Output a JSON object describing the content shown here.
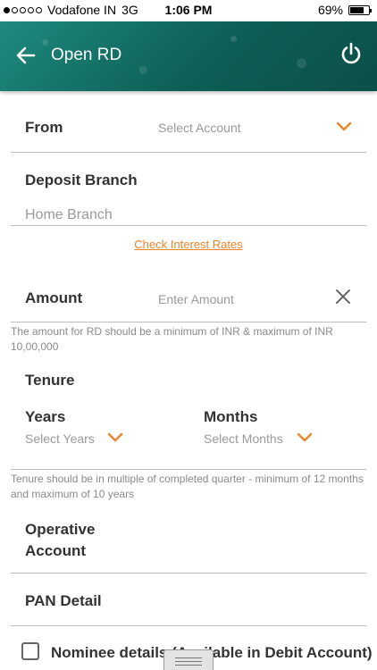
{
  "status_bar": {
    "carrier": "Vodafone IN",
    "network": "3G",
    "time": "1:06 PM",
    "battery_percent": "69%",
    "battery_level": 0.69,
    "signal_bars_filled": 1,
    "signal_bars_total": 5
  },
  "header": {
    "title": "Open RD",
    "back_icon": "arrow-left-icon",
    "power_icon": "power-icon",
    "background_color": "#0d5f57"
  },
  "form": {
    "from": {
      "label": "From",
      "placeholder": "Select Account"
    },
    "deposit_branch": {
      "label": "Deposit Branch",
      "value": "Home Branch"
    },
    "check_rates_link": "Check Interest Rates",
    "amount": {
      "label": "Amount",
      "placeholder": "Enter Amount",
      "hint": "The amount for RD should be a minimum of INR & maximum of INR 10,00,000"
    },
    "tenure": {
      "label": "Tenure",
      "years_label": "Years",
      "years_placeholder": "Select Years",
      "months_label": "Months",
      "months_placeholder": "Select Months",
      "hint": "Tenure should be in multiple of completed quarter - minimum of 12 months and maximum of 10 years"
    },
    "operative_account": {
      "label_line1": "Operative",
      "label_line2": "Account"
    },
    "pan_detail": {
      "label": "PAN Detail"
    },
    "nominee": {
      "label": "Nominee details (Available in Debit Account)",
      "checked": false
    }
  },
  "colors": {
    "accent": "#e8852a",
    "header_teal": "#1f8a7e"
  }
}
